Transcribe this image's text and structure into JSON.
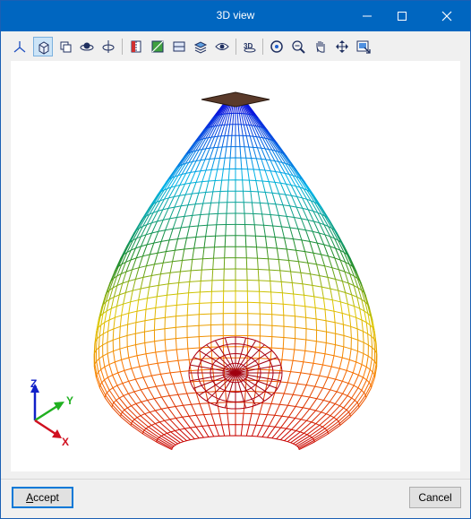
{
  "window": {
    "title": "3D view"
  },
  "toolbar": {
    "tools": [
      {
        "name": "axes-view-icon"
      },
      {
        "name": "3d-box-view-icon",
        "active": true
      },
      {
        "name": "rotate-views-icon"
      },
      {
        "name": "orbit-icon"
      },
      {
        "name": "rotate-axis-icon"
      },
      {
        "name": "section-plane-icon"
      },
      {
        "name": "color-map-icon"
      },
      {
        "name": "panel-icon"
      },
      {
        "name": "layers-icon"
      },
      {
        "name": "visibility-eye-icon"
      },
      {
        "name": "3d-mode-icon"
      },
      {
        "name": "zoom-window-icon"
      },
      {
        "name": "zoom-out-icon"
      },
      {
        "name": "pan-hand-icon"
      },
      {
        "name": "move-arrows-icon"
      },
      {
        "name": "export-image-icon"
      }
    ],
    "mode_3d_label": "3D"
  },
  "axes": {
    "z": "Z",
    "y": "Y",
    "x": "X",
    "colors": {
      "z": "#1020c8",
      "y": "#20b020",
      "x": "#d01020"
    }
  },
  "footer": {
    "accept_label": "Accept",
    "accept_mnemonic": "A",
    "accept_rest": "ccept",
    "cancel_label": "Cancel"
  },
  "colors": {
    "titlebar": "#0066c0",
    "plate": "#5a3a2a"
  }
}
